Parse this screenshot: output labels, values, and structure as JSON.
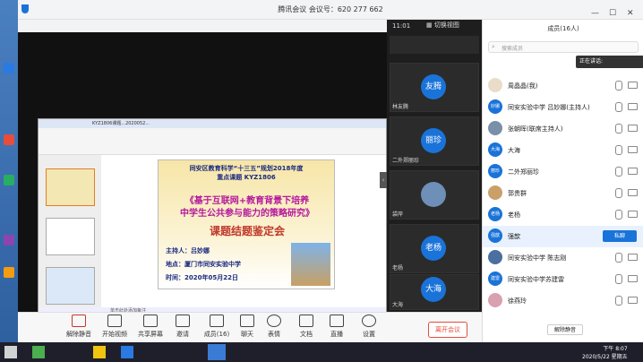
{
  "window": {
    "title": "腾讯会议  会议号：620 277 662",
    "time": "11:01",
    "switch_view": "切换视图"
  },
  "members_panel": {
    "title": "成员(16人)",
    "search_placeholder": "搜索成员",
    "speaking_label": "正在讲话:",
    "mute_all": "解除静音",
    "rows": [
      {
        "avatar": "",
        "name": "周晶晶(我)",
        "color": "#e9dcc8"
      },
      {
        "avatar": "妙娜",
        "name": "同安实验中学 吕妙娜(主持人)",
        "color": "#1a73d9"
      },
      {
        "avatar": "",
        "name": "张朝晖(联席主持人)",
        "color": "#7a8fa8"
      },
      {
        "avatar": "大海",
        "name": "大海",
        "color": "#1a73d9"
      },
      {
        "avatar": "丽珍",
        "name": "二外郑丽珍",
        "color": "#1a73d9"
      },
      {
        "avatar": "",
        "name": "郭贵群",
        "color": "#c9a06a"
      },
      {
        "avatar": "老杨",
        "name": "老杨",
        "color": "#1a73d9"
      },
      {
        "avatar": "强歆",
        "name": "强歆",
        "color": "#1a73d9"
      },
      {
        "avatar": "",
        "name": "同安实验中学 陈志刚",
        "color": "#4a6fa0"
      },
      {
        "avatar": "建雷",
        "name": "同安实验中学苏建雷",
        "color": "#1a73d9"
      },
      {
        "avatar": "",
        "name": "徐燕玲",
        "color": "#d9a0b0"
      }
    ],
    "private_chat": "私聊"
  },
  "video_tiles": [
    {
      "avatar": "友腾",
      "name": "林友腾"
    },
    {
      "avatar": "丽珍",
      "name": "二外郑丽珍"
    },
    {
      "avatar": "",
      "name": "袋岸"
    },
    {
      "avatar": "老杨",
      "name": "老杨"
    },
    {
      "avatar": "大海",
      "name": "大海"
    }
  ],
  "toolbar": {
    "unmute": "解除静音",
    "video": "开始视频",
    "share": "共享屏幕",
    "invite": "邀请",
    "members": "成员(16)",
    "chat": "聊天",
    "emoji": "表情",
    "docs": "文档",
    "live": "直播",
    "settings": "设置",
    "leave": "离开会议"
  },
  "slide": {
    "line1": "同安区教育科学“十三五”规划2018年度",
    "line2": "重点课题 KYZ1806",
    "title1": "《基于互联网+教育背景下培养",
    "title2": "中学生公共参与能力的策略研究》",
    "subtitle": "课题结题鉴定会",
    "host": "主持人：吕妙娜",
    "place": "地点：厦门市同安实验中学",
    "date": "时间：2020年05月22日"
  },
  "doc": {
    "tab": "KYZ1806课题...2020052...",
    "status": "单击此处添加备注"
  },
  "taskbar": {
    "time": "下午 8:07",
    "date": "2020/5/22 星期五"
  }
}
